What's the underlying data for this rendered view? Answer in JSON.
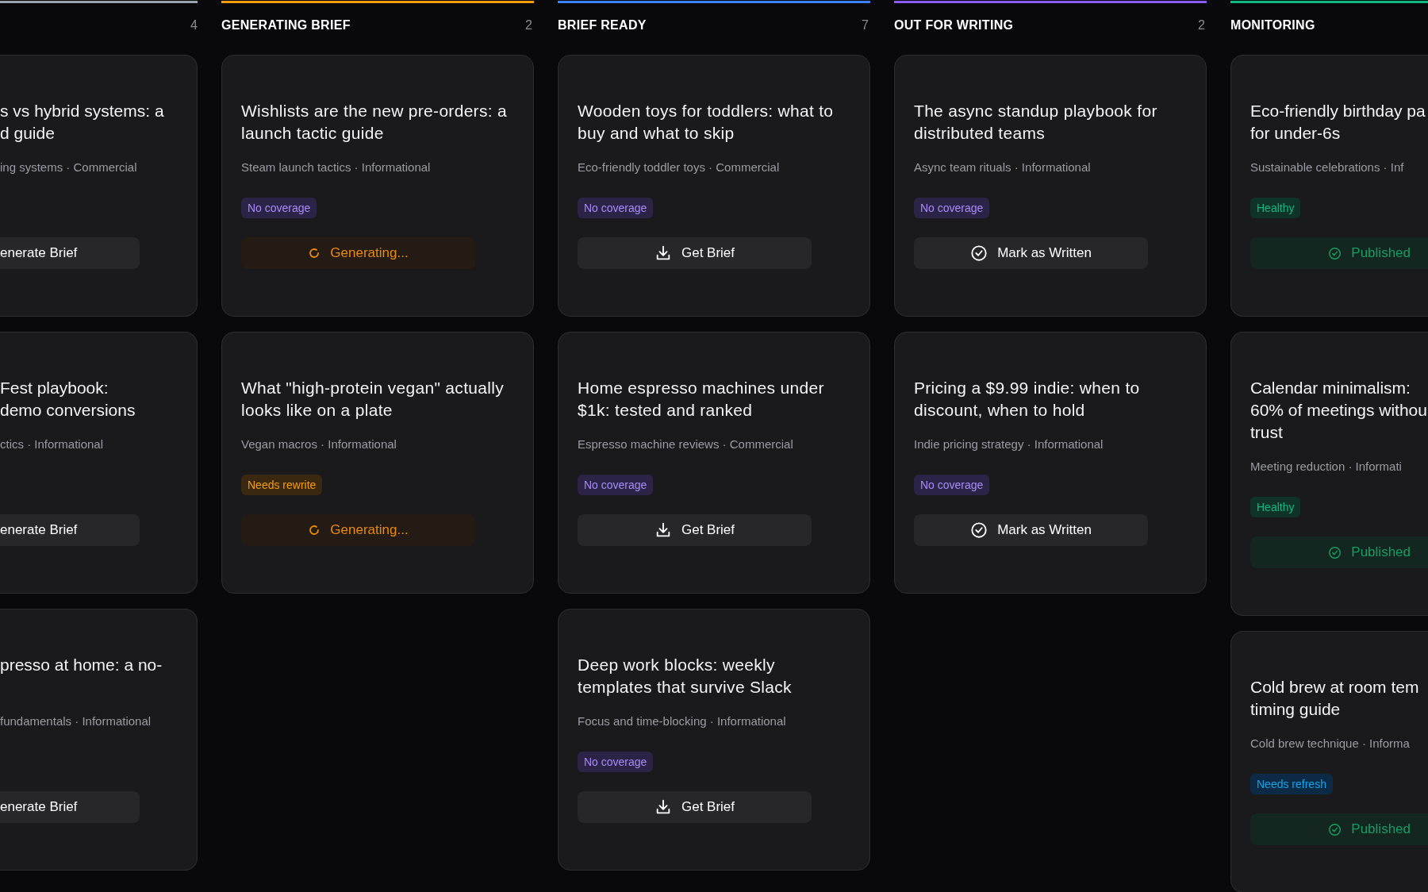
{
  "columns": [
    {
      "kind": "leftcut",
      "count": "4",
      "color": "#9ca3af",
      "cards": [
        {
          "title_lines": [
            "s vs hybrid systems: a",
            "d guide"
          ],
          "meta": "ing systems · Commercial",
          "action": {
            "kind": "generate",
            "label": "enerate Brief"
          }
        },
        {
          "title_lines": [
            "Fest playbook:",
            "demo conversions"
          ],
          "meta": "ctics · Informational",
          "action": {
            "kind": "generate",
            "label": "enerate Brief"
          }
        },
        {
          "title_lines": [
            "presso at home: a no-"
          ],
          "meta": "fundamentals · Informational",
          "action": {
            "kind": "generate",
            "label": "enerate Brief"
          }
        }
      ]
    },
    {
      "kind": "full",
      "title": "GENERATING BRIEF",
      "count": "2",
      "color": "#f59e0b",
      "cards": [
        {
          "title": "Wishlists are the new pre-orders: a launch tactic guide",
          "meta": "Steam launch tactics · Informational",
          "badge": {
            "color": "#2c2446",
            "label": "No coverage"
          },
          "action": {
            "kind": "generating",
            "label": "Generating..."
          }
        },
        {
          "title": "What \"high-protein vegan\" actually looks like on a plate",
          "meta": "Vegan macros · Informational",
          "badge": {
            "color": "#3a2811",
            "label": "Needs rewrite"
          },
          "action": {
            "kind": "generating",
            "label": "Generating..."
          }
        }
      ]
    },
    {
      "kind": "full",
      "title": "BRIEF READY",
      "count": "7",
      "color": "#3b82f6",
      "cards": [
        {
          "title": "Wooden toys for toddlers: what to buy and what to skip",
          "meta": "Eco-friendly toddler toys · Commercial",
          "badge": {
            "color": "#2c2446",
            "label": "No coverage"
          },
          "action": {
            "kind": "get_brief",
            "label": "Get Brief"
          }
        },
        {
          "title": "Home espresso machines under $1k: tested and ranked",
          "meta": "Espresso machine reviews · Commercial",
          "badge": {
            "color": "#2c2446",
            "label": "No coverage"
          },
          "action": {
            "kind": "get_brief",
            "label": "Get Brief"
          }
        },
        {
          "title": "Deep work blocks: weekly templates that survive Slack",
          "meta": "Focus and time-blocking · Informational",
          "badge": {
            "color": "#2c2446",
            "label": "No coverage"
          },
          "action": {
            "kind": "get_brief",
            "label": "Get Brief"
          }
        }
      ]
    },
    {
      "kind": "full",
      "title": "OUT FOR WRITING",
      "count": "2",
      "color": "#8b5cf6",
      "cards": [
        {
          "title": "The async standup playbook for distributed teams",
          "meta": "Async team rituals · Informational",
          "badge": {
            "color": "#2c2446",
            "label": "No coverage"
          },
          "action": {
            "kind": "mark_written",
            "label": "Mark as Written"
          }
        },
        {
          "title": "Pricing a $9.99 indie: when to discount, when to hold",
          "meta": "Indie pricing strategy · Informational",
          "badge": {
            "color": "#2c2446",
            "label": "No coverage"
          },
          "action": {
            "kind": "mark_written",
            "label": "Mark as Written"
          }
        }
      ]
    },
    {
      "kind": "rightcut",
      "title": "MONITORING",
      "color": "#10b981",
      "cards": [
        {
          "title_lines": [
            "Eco-friendly birthday pa",
            "for under-6s"
          ],
          "meta": "Sustainable celebrations · Inf",
          "badge": {
            "color": "#103329",
            "label": "Healthy"
          },
          "action": {
            "kind": "published",
            "label": "Published"
          }
        },
        {
          "title_lines": [
            "Calendar minimalism:",
            "60% of meetings withou",
            "trust"
          ],
          "meta": "Meeting reduction · Informati",
          "badge": {
            "color": "#103329",
            "label": "Healthy"
          },
          "action": {
            "kind": "published",
            "label": "Published"
          }
        },
        {
          "title_lines": [
            "Cold brew at room tem",
            "timing guide"
          ],
          "meta": "Cold brew technique · Informa",
          "badge": {
            "color": "#0c2a45",
            "label": "Needs refresh"
          },
          "action": {
            "kind": "published",
            "label": "Published"
          }
        }
      ]
    }
  ]
}
